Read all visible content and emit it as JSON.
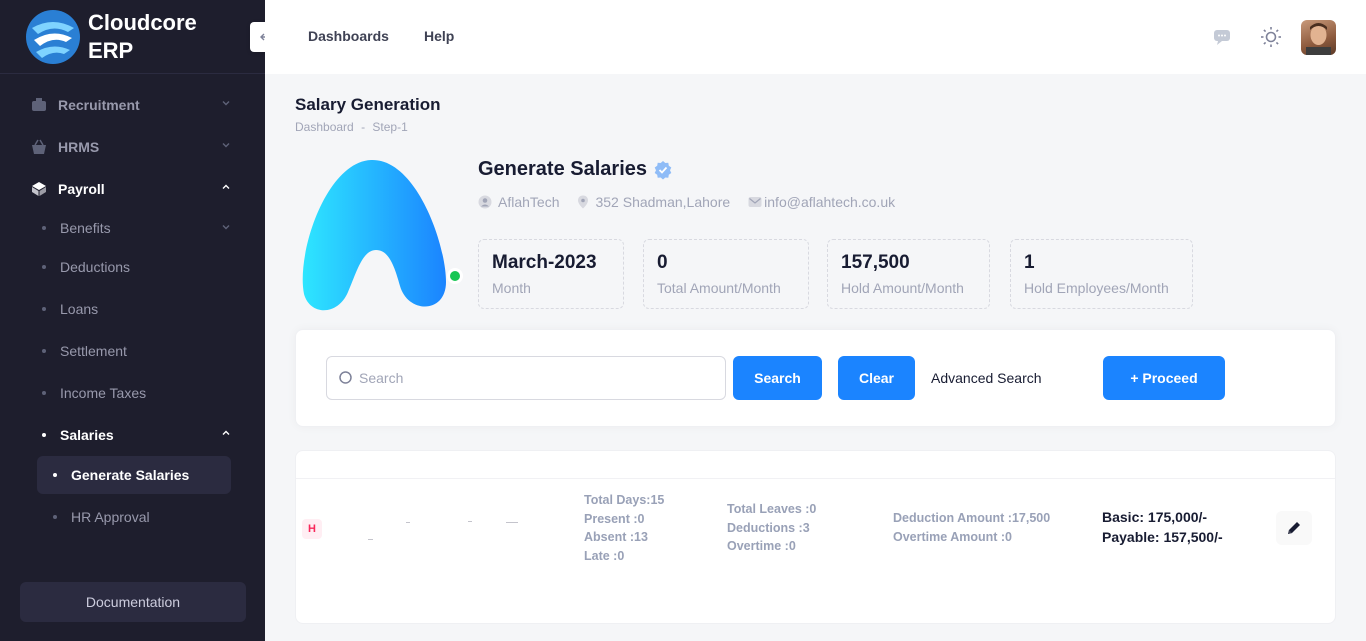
{
  "brand": {
    "name_line1": "Cloudcore",
    "name_line2": "ERP"
  },
  "sidebar": {
    "items": [
      {
        "label": "Recruitment"
      },
      {
        "label": "HRMS"
      },
      {
        "label": "Payroll"
      }
    ],
    "payroll_sub": [
      {
        "label": "Benefits"
      },
      {
        "label": "Deductions"
      },
      {
        "label": "Loans"
      },
      {
        "label": "Settlement"
      },
      {
        "label": "Income Taxes"
      },
      {
        "label": "Salaries"
      }
    ],
    "salaries_sub": [
      {
        "label": "Generate Salaries"
      },
      {
        "label": "HR Approval"
      }
    ],
    "documentation": "Documentation"
  },
  "header": {
    "links": [
      "Dashboards",
      "Help"
    ]
  },
  "page": {
    "title": "Salary Generation",
    "breadcrumb": [
      "Dashboard",
      "-",
      "Step-1"
    ]
  },
  "profile": {
    "name": "Generate Salaries",
    "company": "AflahTech",
    "address": "352 Shadman,Lahore",
    "email": "info@aflahtech.co.uk"
  },
  "stats": [
    {
      "value": "March-2023",
      "label": "Month"
    },
    {
      "value": "0",
      "label": "Total Amount/Month"
    },
    {
      "value": "157,500",
      "label": "Hold Amount/Month"
    },
    {
      "value": "1",
      "label": "Hold Employees/Month"
    }
  ],
  "search": {
    "placeholder": "Search",
    "search_btn": "Search",
    "clear_btn": "Clear",
    "advanced": "Advanced Search",
    "proceed_btn": "+ Proceed"
  },
  "row": {
    "badge": "H",
    "col1": [
      "Total Days:15",
      "Present :0",
      "Absent :13",
      "Late :0"
    ],
    "col2": [
      "Total Leaves :0",
      "Deductions :3",
      "Overtime :0"
    ],
    "col3": [
      "Deduction Amount :17,500",
      "Overtime Amount :0"
    ],
    "col4": [
      "Basic: 175,000/-",
      "Payable: 157,500/-"
    ]
  },
  "colors": {
    "accent": "#1b84ff",
    "sidebar": "#1e1e2d",
    "online": "#17c653"
  }
}
